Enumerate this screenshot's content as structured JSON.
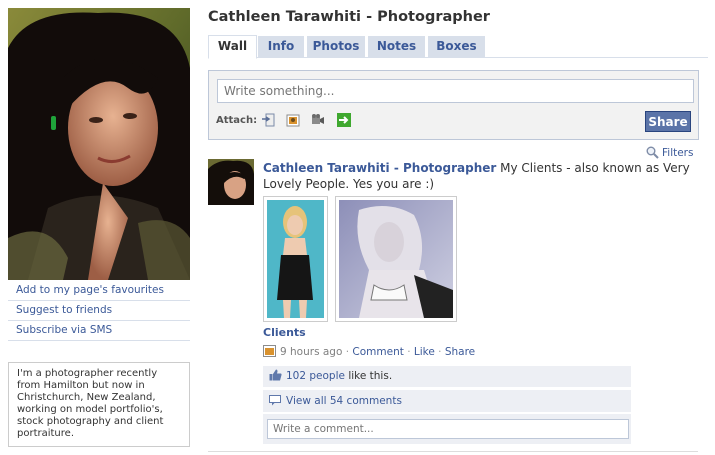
{
  "profile": {
    "links": [
      "Add to my page's favourites",
      "Suggest to friends",
      "Subscribe via SMS"
    ],
    "bio": "I'm a photographer recently from Hamilton but now in Christchurch, New Zealand, working on model portfolio's, stock photography and client portraiture."
  },
  "page": {
    "title": "Cathleen Tarawhiti - Photographer",
    "tabs": [
      "Wall",
      "Info",
      "Photos",
      "Notes",
      "Boxes"
    ],
    "active_tab": "Wall"
  },
  "publisher": {
    "placeholder": "Write something...",
    "attach_label": "Attach:",
    "attach_icons": [
      "status-icon",
      "photo-icon",
      "video-icon",
      "link-icon"
    ],
    "share_label": "Share"
  },
  "filters_label": "Filters",
  "story": {
    "actor": "Cathleen Tarawhiti - Photographer",
    "message": " My Clients - also known as Very Lovely People. Yes you are :)",
    "album_link": "Clients",
    "time": "9 hours ago",
    "comment_action": "Comment",
    "like_action": "Like",
    "share_action": "Share",
    "likes_count": "102 people",
    "likes_suffix": " like this.",
    "view_comments": "View all 54 comments",
    "comment_placeholder": "Write a comment..."
  },
  "colors": {
    "link": "#3b5998",
    "tab_bg": "#d8dfea",
    "share_button": "#5b74a8",
    "feedback_bg": "#edeff4"
  }
}
